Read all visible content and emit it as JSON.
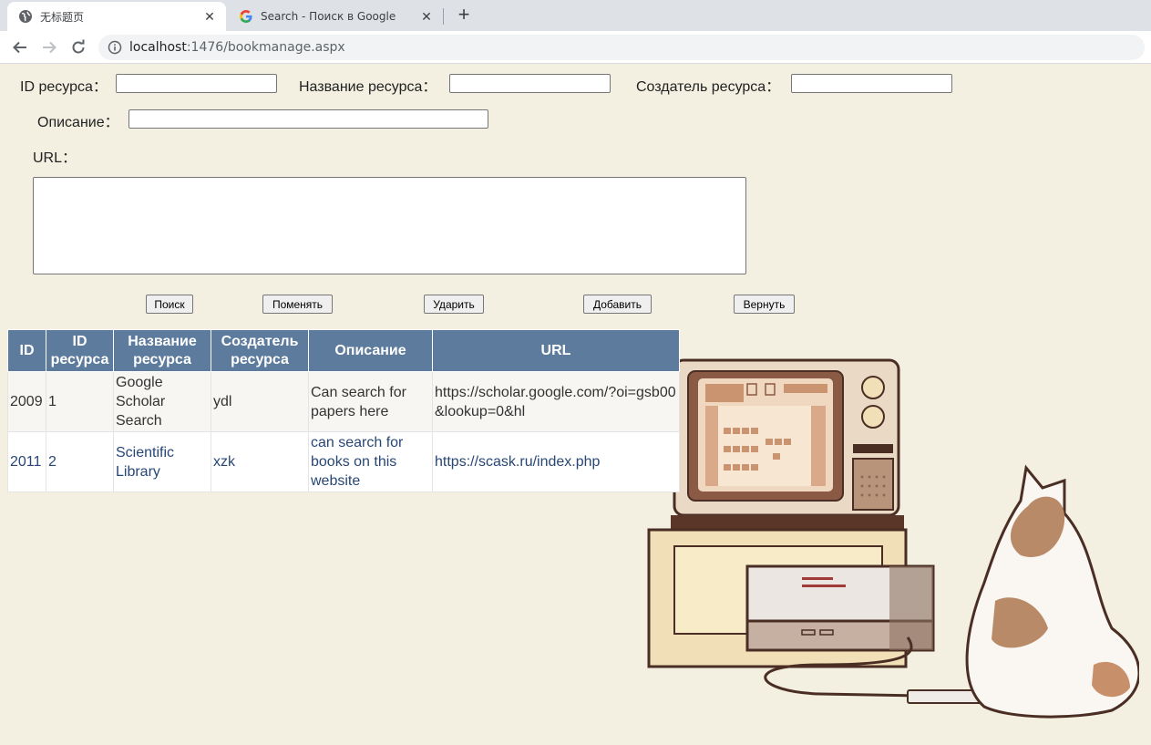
{
  "browser": {
    "tabs": [
      {
        "title": "无标题页",
        "active": true,
        "icon": "globe-icon"
      },
      {
        "title": "Search - Поиск в Google",
        "active": false,
        "icon": "google-icon"
      }
    ],
    "url_host": "localhost",
    "url_rest": ":1476/bookmanage.aspx"
  },
  "form": {
    "id_label": "ID ресурса：",
    "name_label": "Название ресурса：",
    "creator_label": "Создатель ресурса：",
    "description_label": "Описание：",
    "url_label": "URL：",
    "id_value": "",
    "name_value": "",
    "creator_value": "",
    "description_value": "",
    "url_value": ""
  },
  "buttons": {
    "search": "Поиск",
    "change": "Поменять",
    "delete": "Ударить",
    "add": "Добавить",
    "back": "Вернуть"
  },
  "table": {
    "headers": [
      "ID",
      "ID ресурса",
      "Название ресурса",
      "Создатель ресурса",
      "Описание",
      "URL"
    ],
    "rows": [
      {
        "id": "2009",
        "resource_id": "1",
        "name": "Google Scholar Search",
        "creator": "ydl",
        "description": "Can search for papers here",
        "url": "https://scholar.google.com/?oi=gsb00&lookup=0&hl"
      },
      {
        "id": "2011",
        "resource_id": "2",
        "name": "Scientific Library",
        "creator": "xzk",
        "description": "can search for books on this website",
        "url": "https://scask.ru/index.php"
      }
    ]
  },
  "colors": {
    "page_background": "#f3f0e2",
    "header_background": "#5d7b9d",
    "row_text_alt": "#284775"
  }
}
